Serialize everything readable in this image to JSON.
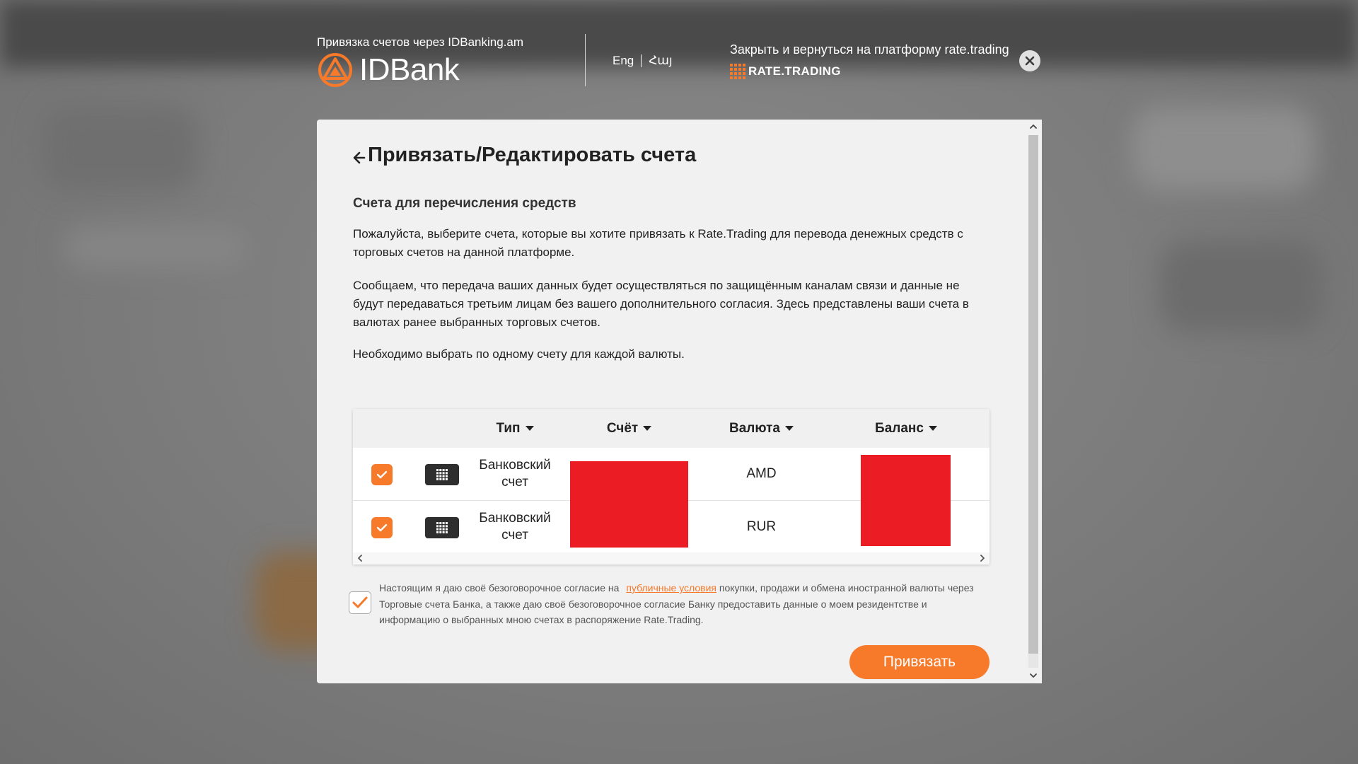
{
  "header": {
    "subtitle": "Привязка счетов через IDBanking.am",
    "logo_text": "IDBank",
    "lang_en": "Eng",
    "lang_hy": "Հայ",
    "close_text": "Закрыть и вернуться на платформу rate.trading",
    "partner_logo": "RATE.TRADING"
  },
  "page": {
    "title": "Привязать/Редактировать счета",
    "section_title": "Счета для перечисления средств",
    "paragraph1": "Пожалуйста, выберите счета, которые вы хотите привязать к Rate.Trading для перевода денежных средств с торговых счетов на данной платформе.",
    "paragraph2": "Сообщаем, что передача ваших данных будет осуществляться по защищённым каналам связи и данные не будут передаваться третьим лицам без вашего дополнительного согласия. Здесь представлены ваши счета в валютах ранее выбранных торговых счетов.",
    "paragraph3": "Необходимо выбрать по одному счету для каждой валюты."
  },
  "table": {
    "columns": [
      "Тип",
      "Счёт",
      "Валюта",
      "Баланс"
    ],
    "rows": [
      {
        "type": "Банковский счет",
        "currency": "AMD",
        "checked": true
      },
      {
        "type": "Банковский счет",
        "currency": "RUR",
        "checked": true
      }
    ]
  },
  "consent": {
    "text_before": "Настоящим я даю своё безоговорочное согласие на",
    "link_text": "публичные условия",
    "text_after": "покупки, продажи и обмена иностранной валюты через Торговые счета Банка, а также даю своё безоговорочное согласие Банку предоставить данные о моем резидентстве и информацию о выбранных мною счетах в распоряжение Rate.Trading.",
    "checked": true
  },
  "actions": {
    "submit_label": "Привязать"
  },
  "colors": {
    "accent": "#f7792a",
    "redaction": "#ec1c24",
    "modal_bg": "#f1f1f1",
    "overlay": "#7d7d7d"
  },
  "icons": {
    "logo": "idbank-logo-icon",
    "close": "close-icon",
    "back": "arrow-left-icon",
    "card": "bank-card-icon",
    "check": "checkmark-icon",
    "sort": "caret-down-icon"
  }
}
